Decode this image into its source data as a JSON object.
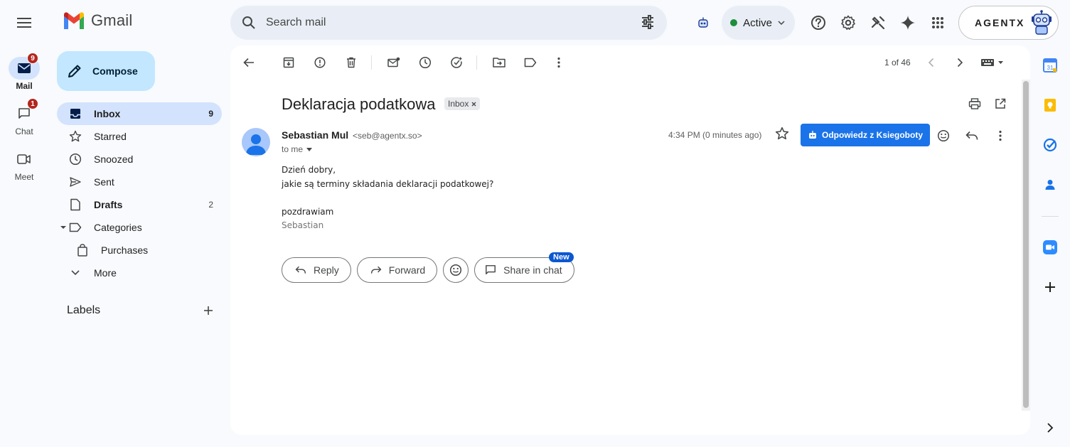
{
  "app": {
    "name": "Gmail"
  },
  "rail": [
    {
      "label": "Mail",
      "badge": "9",
      "icon": "mail-icon",
      "active": true
    },
    {
      "label": "Chat",
      "badge": "1",
      "icon": "chat-icon",
      "active": false
    },
    {
      "label": "Meet",
      "badge": "",
      "icon": "video-icon",
      "active": false
    }
  ],
  "search": {
    "placeholder": "Search mail"
  },
  "status": {
    "label": "Active",
    "color": "#1e8e3e"
  },
  "account": {
    "brand": "AGENTX"
  },
  "compose": {
    "label": "Compose"
  },
  "nav": [
    {
      "label": "Inbox",
      "count": "9",
      "icon": "inbox-icon"
    },
    {
      "label": "Starred",
      "count": "",
      "icon": "star-icon"
    },
    {
      "label": "Snoozed",
      "count": "",
      "icon": "clock-icon"
    },
    {
      "label": "Sent",
      "count": "",
      "icon": "send-icon"
    },
    {
      "label": "Drafts",
      "count": "2",
      "icon": "draft-icon"
    },
    {
      "label": "Categories",
      "count": "",
      "icon": "label-icon"
    },
    {
      "label": "Purchases",
      "count": "",
      "icon": "bag-icon"
    },
    {
      "label": "More",
      "count": "",
      "icon": "chevron-down-icon"
    }
  ],
  "labels": {
    "heading": "Labels"
  },
  "pager": {
    "text": "1 of 46"
  },
  "email": {
    "subject": "Deklaracja podatkowa",
    "tag": "Inbox",
    "sender_name": "Sebastian Mul",
    "sender_email": "<seb@agentx.so>",
    "to": "to me",
    "time": "4:34 PM (0 minutes ago)",
    "reply_button": "Odpowiedz z Ksiegoboty",
    "body": [
      "Dzień dobry,",
      "jakie są terminy składania deklaracji podatkowej?",
      "",
      "pozdrawiam"
    ],
    "signature": "Sebastian"
  },
  "actions": {
    "reply": "Reply",
    "forward": "Forward",
    "share": "Share in chat",
    "new_badge": "New"
  },
  "colors": {
    "accent": "#0b57d0",
    "compose_bg": "#c2e7ff",
    "active_nav": "#d3e3fd",
    "badge_red": "#b3261e",
    "primary_button": "#1a73e8"
  }
}
